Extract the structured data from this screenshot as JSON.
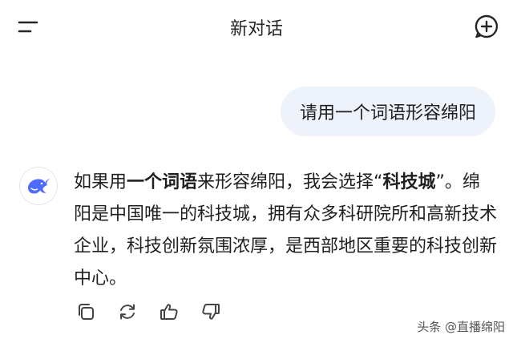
{
  "header": {
    "title": "新对话",
    "menu_icon": "menu-icon",
    "new_chat_icon": "add-chat-icon"
  },
  "conversation": {
    "user_message": "请用一个词语形容绵阳",
    "assistant": {
      "avatar_icon": "whale-logo-icon",
      "reply_parts": [
        {
          "text": "如果用",
          "bold": false
        },
        {
          "text": "一个词语",
          "bold": true
        },
        {
          "text": "来形容绵阳，我会选择“",
          "bold": false
        },
        {
          "text": "科技城",
          "bold": true
        },
        {
          "text": "”。绵阳是中国唯一的科技城，拥有众多科研院所和高新技术企业，科技创新氛围浓厚，是西部地区重要的科技创新中心。",
          "bold": false
        }
      ]
    },
    "actions": [
      {
        "name": "copy-icon"
      },
      {
        "name": "regenerate-icon"
      },
      {
        "name": "thumbs-up-icon"
      },
      {
        "name": "thumbs-down-icon"
      }
    ]
  },
  "watermark": {
    "text": "头条 @直播绵阳"
  },
  "colors": {
    "user_bubble": "#eef2fb",
    "brand_blue": "#4d6bfe",
    "text": "#1f1f1f",
    "icon": "#444444"
  }
}
